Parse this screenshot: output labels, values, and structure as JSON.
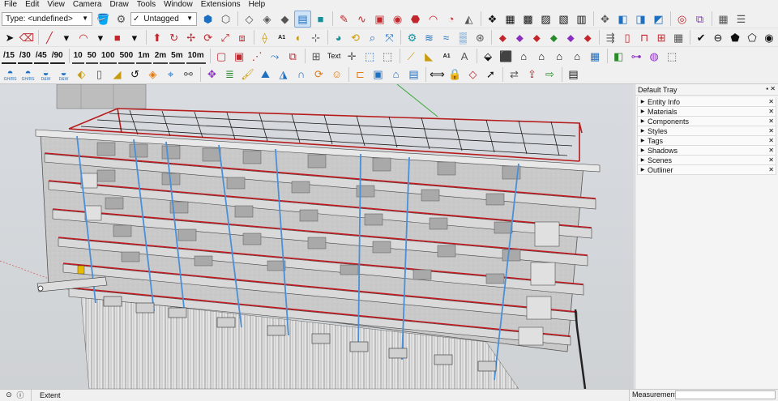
{
  "menubar": [
    "File",
    "Edit",
    "View",
    "Camera",
    "Draw",
    "Tools",
    "Window",
    "Extensions",
    "Help"
  ],
  "toolbar": {
    "type_dropdown": "Type: <undefined>",
    "tag_dropdown": "Untagged",
    "tag_check": "✓",
    "dim_buttons": [
      "/15",
      "/30",
      "/45",
      "/90"
    ],
    "scale_buttons": [
      "10",
      "50",
      "100",
      "500",
      "1m",
      "2m",
      "5m",
      "10m"
    ],
    "text_tool": "Text",
    "box_a1": "A1",
    "box_a2": "A1",
    "gh_labels": [
      "GH/RS",
      "GH/RS",
      "D&W",
      "D&W"
    ]
  },
  "tray": {
    "title": "Default Tray",
    "controls": "▪ ✕",
    "panels": [
      "Entity Info",
      "Materials",
      "Components",
      "Styles",
      "Tags",
      "Shadows",
      "Scenes",
      "Outliner"
    ]
  },
  "status": {
    "text": "Extent",
    "measurements_label": "Measurements"
  },
  "colors": {
    "accent": "#1f6fc0",
    "structure_red": "#c0191f",
    "column_blue": "#4a90d9",
    "viewport_bg": "#d6d9dc"
  }
}
